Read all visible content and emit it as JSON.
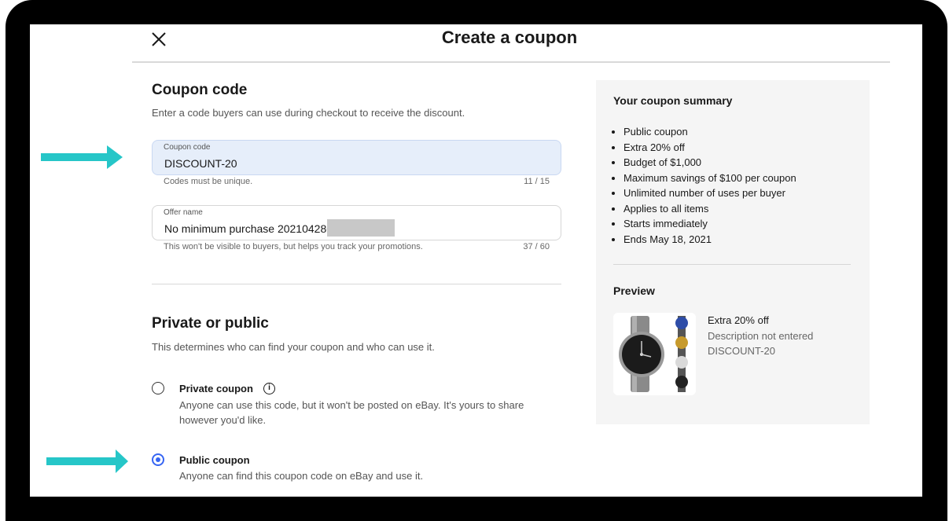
{
  "header": {
    "title": "Create a coupon"
  },
  "coupon_code_section": {
    "heading": "Coupon code",
    "description": "Enter a code buyers can use during checkout to receive the discount.",
    "code_field": {
      "label": "Coupon code",
      "value": "DISCOUNT-20",
      "hint": "Codes must be unique.",
      "counter": "11 / 15"
    },
    "offer_field": {
      "label": "Offer name",
      "value": "No minimum purchase 202104280",
      "hint": "This won't be visible to buyers, but helps you track your promotions.",
      "counter": "37 / 60"
    }
  },
  "visibility_section": {
    "heading": "Private or public",
    "description": "This determines who can find your coupon and who can use it.",
    "options": [
      {
        "label": "Private coupon",
        "description": "Anyone can use this code, but it won't be posted on eBay. It's yours to share however you'd like.",
        "selected": false
      },
      {
        "label": "Public coupon",
        "description": "Anyone can find this coupon code on eBay and use it.",
        "selected": true
      }
    ],
    "info_glyph": "i"
  },
  "summary": {
    "heading": "Your coupon summary",
    "items": [
      "Public coupon",
      "Extra 20% off",
      "Budget of $1,000",
      "Maximum savings of $100 per coupon",
      "Unlimited number of uses per buyer",
      "Applies to all items",
      "Starts immediately",
      "Ends May 18, 2021"
    ]
  },
  "preview": {
    "heading": "Preview",
    "title": "Extra 20% off",
    "description": "Description not entered",
    "code": "DISCOUNT-20"
  },
  "colors": {
    "accent": "#3665f3",
    "arrow": "#26c6c8",
    "active_field": "#e6eefa",
    "summary_bg": "#f5f5f5"
  },
  "icons": {
    "close": "close-icon",
    "info": "info-icon",
    "arrow": "arrow-right-icon"
  }
}
